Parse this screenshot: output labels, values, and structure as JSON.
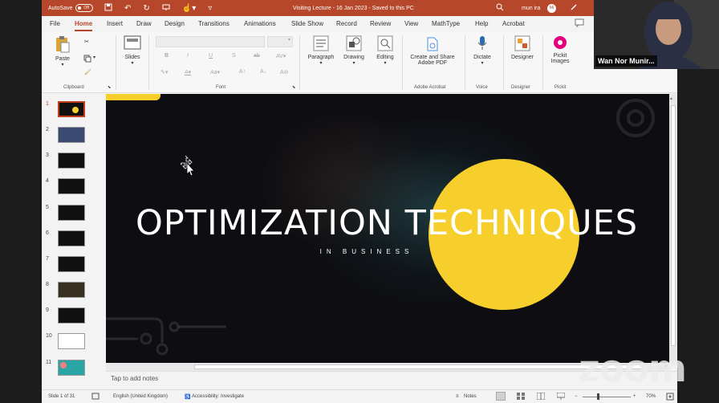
{
  "titlebar": {
    "autosave_label": "AutoSave",
    "autosave_state": "Off",
    "doc_title": "Visiting Lecture - 16 Jan 2023 - Saved to this PC",
    "user_name": "mun ira",
    "user_initials": "MI"
  },
  "menu": {
    "tabs": [
      "File",
      "Home",
      "Insert",
      "Draw",
      "Design",
      "Transitions",
      "Animations",
      "Slide Show",
      "Record",
      "Review",
      "View",
      "MathType",
      "Help",
      "Acrobat"
    ],
    "active": "Home"
  },
  "ribbon": {
    "paste": "Paste",
    "clipboard": "Clipboard",
    "slides": "Slides",
    "font": "Font",
    "paragraph": "Paragraph",
    "drawing": "Drawing",
    "editing": "Editing",
    "create_share_1": "Create and Share",
    "create_share_2": "Adobe PDF",
    "adobe_acrobat": "Adobe Acrobat",
    "dictate": "Dictate",
    "voice": "Voice",
    "designer": "Designer",
    "designer_group": "Designer",
    "pickit_1": "Pickit",
    "pickit_2": "Images",
    "pickit_group": "Pickit"
  },
  "thumbnails": [
    "1",
    "2",
    "3",
    "4",
    "5",
    "6",
    "7",
    "8",
    "9",
    "10",
    "11"
  ],
  "slide": {
    "title": "OPTIMIZATION TECHNIQUES",
    "subtitle": "IN BUSINESS",
    "accent": "#f7cf2c"
  },
  "notes_placeholder": "Tap to add notes",
  "status": {
    "slide_pos": "Slide 1 of 31",
    "language": "English (United Kingdom)",
    "accessibility": "Accessibility: Investigate",
    "notes": "Notes",
    "zoom": "70%"
  },
  "camera": {
    "participant": "Wan Nor Munir..."
  },
  "zoom_watermark": "zoom"
}
